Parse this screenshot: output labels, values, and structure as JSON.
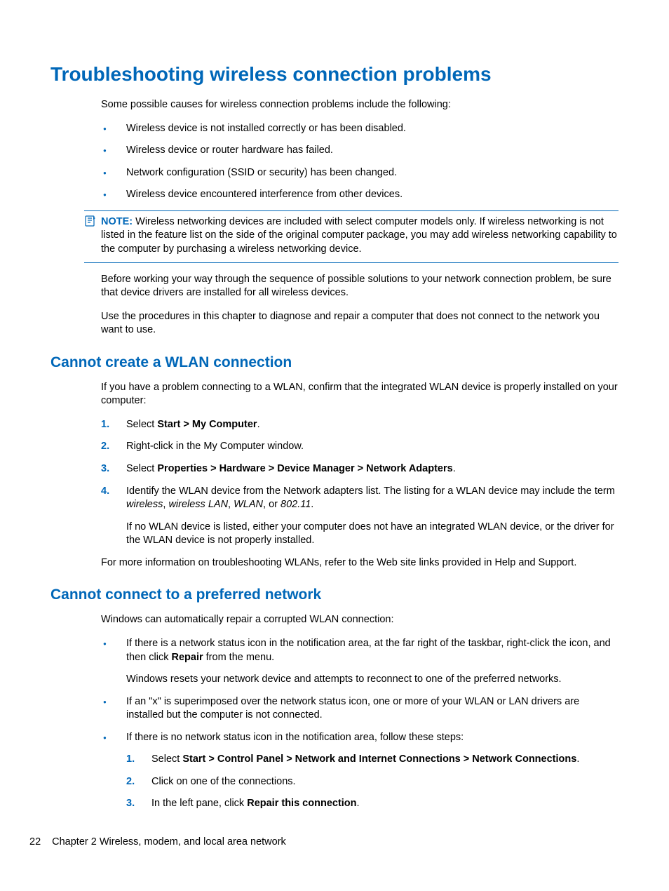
{
  "h1": "Troubleshooting wireless connection problems",
  "intro": "Some possible causes for wireless connection problems include the following:",
  "causes": [
    "Wireless device is not installed correctly or has been disabled.",
    "Wireless device or router hardware has failed.",
    "Network configuration (SSID or security) has been changed.",
    "Wireless device encountered interference from other devices."
  ],
  "note": {
    "label": "NOTE:",
    "text": "Wireless networking devices are included with select computer models only. If wireless networking is not listed in the feature list on the side of the original computer package, you may add wireless networking capability to the computer by purchasing a wireless networking device."
  },
  "post_note_1": "Before working your way through the sequence of possible solutions to your network connection problem, be sure that device drivers are installed for all wireless devices.",
  "post_note_2": "Use the procedures in this chapter to diagnose and repair a computer that does not connect to the network you want to use.",
  "sec1": {
    "title": "Cannot create a WLAN connection",
    "intro": "If you have a problem connecting to a WLAN, confirm that the integrated WLAN device is properly installed on your computer:",
    "steps": {
      "s1_pre": "Select ",
      "s1_bold": "Start > My Computer",
      "s1_post": ".",
      "s2": "Right-click in the My Computer window.",
      "s3_pre": "Select ",
      "s3_bold": "Properties > Hardware > Device Manager > Network Adapters",
      "s3_post": ".",
      "s4_main_a": "Identify the WLAN device from the Network adapters list. The listing for a WLAN device may include the term ",
      "s4_i1": "wireless",
      "s4_c1": ", ",
      "s4_i2": "wireless LAN",
      "s4_c2": ", ",
      "s4_i3": "WLAN",
      "s4_c3": ", or ",
      "s4_i4": "802.11",
      "s4_c4": ".",
      "s4_sub": "If no WLAN device is listed, either your computer does not have an integrated WLAN device, or the driver for the WLAN device is not properly installed."
    },
    "outro": "For more information on troubleshooting WLANs, refer to the Web site links provided in Help and Support."
  },
  "sec2": {
    "title": "Cannot connect to a preferred network",
    "intro": "Windows can automatically repair a corrupted WLAN connection:",
    "b1_a": "If there is a network status icon in the notification area, at the far right of the taskbar, right-click the icon, and then click ",
    "b1_bold": "Repair",
    "b1_b": " from the menu.",
    "b1_sub": "Windows resets your network device and attempts to reconnect to one of the preferred networks.",
    "b2": "If an \"x\" is superimposed over the network status icon, one or more of your WLAN or LAN drivers are installed but the computer is not connected.",
    "b3": "If there is no network status icon in the notification area, follow these steps:",
    "b3_steps": {
      "n1_pre": "Select ",
      "n1_bold": "Start > Control Panel > Network and Internet Connections > Network Connections",
      "n1_post": ".",
      "n2": "Click on one of the connections.",
      "n3_pre": "In the left pane, click ",
      "n3_bold": "Repair this connection",
      "n3_post": "."
    }
  },
  "footer": {
    "page": "22",
    "chapter": "Chapter 2   Wireless, modem, and local area network"
  }
}
